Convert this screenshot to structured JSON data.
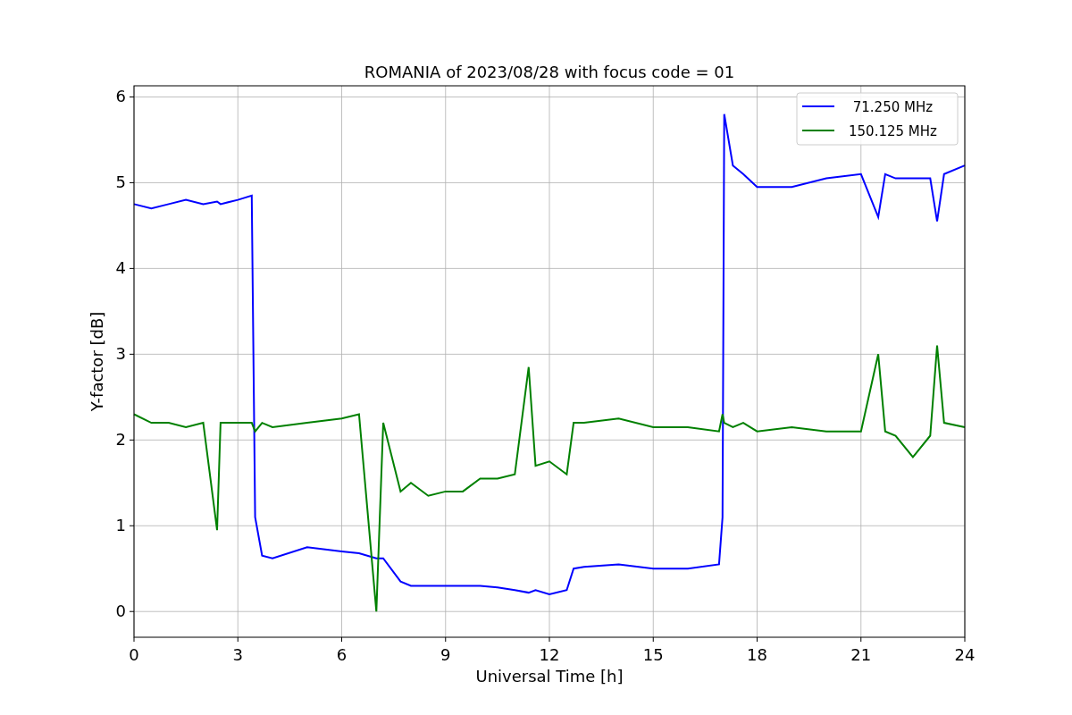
{
  "chart_data": {
    "type": "line",
    "title": "ROMANIA of 2023/08/28 with focus code = 01",
    "xlabel": "Universal Time [h]",
    "ylabel": "Y-factor [dB]",
    "x": [
      0,
      0.5,
      1,
      1.5,
      2,
      2.4,
      2.5,
      3,
      3.4,
      3.5,
      3.7,
      4,
      5,
      6,
      6.5,
      7,
      7.2,
      7.7,
      8,
      8.5,
      9,
      9.5,
      10,
      10.5,
      11,
      11.4,
      11.6,
      12,
      12.5,
      12.7,
      13,
      14,
      15,
      16,
      16.9,
      17,
      17.05,
      17.3,
      17.6,
      18,
      19,
      20,
      21,
      21.5,
      21.7,
      22,
      22.5,
      23,
      23.2,
      23.4,
      24
    ],
    "series": [
      {
        "name": " 71.250 MHz",
        "color": "#0000ff",
        "values": [
          4.75,
          4.7,
          4.75,
          4.8,
          4.75,
          4.78,
          4.75,
          4.8,
          4.85,
          1.1,
          0.65,
          0.62,
          0.75,
          0.7,
          0.68,
          0.62,
          0.62,
          0.35,
          0.3,
          0.3,
          0.3,
          0.3,
          0.3,
          0.28,
          0.25,
          0.22,
          0.25,
          0.2,
          0.25,
          0.5,
          0.52,
          0.55,
          0.5,
          0.5,
          0.55,
          1.1,
          5.8,
          5.2,
          5.1,
          4.95,
          4.95,
          5.05,
          5.1,
          4.6,
          5.1,
          5.05,
          5.05,
          5.05,
          4.55,
          5.1,
          5.2
        ]
      },
      {
        "name": "150.125 MHz",
        "color": "#008000",
        "values": [
          2.3,
          2.2,
          2.2,
          2.15,
          2.2,
          0.95,
          2.2,
          2.2,
          2.2,
          2.1,
          2.2,
          2.15,
          2.2,
          2.25,
          2.3,
          0,
          2.2,
          1.4,
          1.5,
          1.35,
          1.4,
          1.4,
          1.55,
          1.55,
          1.6,
          2.85,
          1.7,
          1.75,
          1.6,
          2.2,
          2.2,
          2.25,
          2.15,
          2.15,
          2.1,
          2.3,
          2.2,
          2.15,
          2.2,
          2.1,
          2.15,
          2.1,
          2.1,
          3.0,
          2.1,
          2.05,
          1.8,
          2.05,
          3.1,
          2.2,
          2.15
        ]
      }
    ],
    "grid": true,
    "legend": true,
    "xlim": [
      0,
      24
    ],
    "ylim": [
      -0.3,
      6.13
    ],
    "xticks": [
      0,
      3,
      6,
      9,
      12,
      15,
      18,
      21,
      24
    ],
    "yticks": [
      0,
      1,
      2,
      3,
      4,
      5,
      6
    ]
  }
}
